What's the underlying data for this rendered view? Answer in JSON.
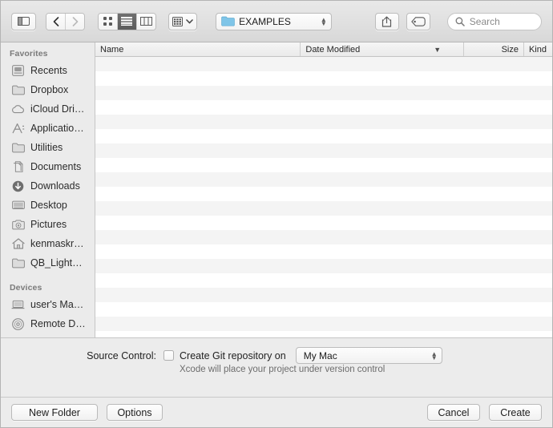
{
  "toolbar": {
    "sidebar_toggle": "sidebar-toggle",
    "back": "back",
    "forward": "forward",
    "view_icon": "icon-view",
    "view_list": "list-view",
    "view_column": "column-view",
    "arrange": "arrange",
    "path_label": "EXAMPLES",
    "share": "share",
    "tags": "tags",
    "search_placeholder": "Search"
  },
  "sidebar": {
    "sections": [
      {
        "header": "Favorites",
        "items": [
          {
            "label": "Recents",
            "icon": "recents-icon"
          },
          {
            "label": "Dropbox",
            "icon": "folder-icon"
          },
          {
            "label": "iCloud Dri…",
            "icon": "cloud-icon"
          },
          {
            "label": "Applicatio…",
            "icon": "applications-icon"
          },
          {
            "label": "Utilities",
            "icon": "folder-icon"
          },
          {
            "label": "Documents",
            "icon": "documents-icon"
          },
          {
            "label": "Downloads",
            "icon": "downloads-icon"
          },
          {
            "label": "Desktop",
            "icon": "desktop-icon"
          },
          {
            "label": "Pictures",
            "icon": "pictures-icon"
          },
          {
            "label": "kenmaskr…",
            "icon": "home-icon"
          },
          {
            "label": "QB_Light…",
            "icon": "folder-icon"
          }
        ]
      },
      {
        "header": "Devices",
        "items": [
          {
            "label": "user's Ma…",
            "icon": "laptop-icon"
          },
          {
            "label": "Remote D…",
            "icon": "remote-disc-icon"
          }
        ]
      }
    ]
  },
  "file_list": {
    "columns": [
      {
        "key": "name",
        "label": "Name"
      },
      {
        "key": "date",
        "label": "Date Modified"
      },
      {
        "key": "size",
        "label": "Size"
      },
      {
        "key": "kind",
        "label": "Kind"
      }
    ],
    "sort_indicator": "chevron-down-icon",
    "rows": [],
    "empty": true
  },
  "source_control": {
    "label": "Source Control:",
    "checkbox_label": "Create Git repository on",
    "checked": false,
    "location": "My Mac",
    "hint": "Xcode will place your project under version control"
  },
  "footer": {
    "new_folder": "New Folder",
    "options": "Options",
    "cancel": "Cancel",
    "create": "Create"
  },
  "colors": {
    "folder_blue": "#7fc5e8",
    "selected_segment": "#5c5c5c",
    "row_stripe": "#f4f4f4",
    "window_bg": "#ececec"
  }
}
